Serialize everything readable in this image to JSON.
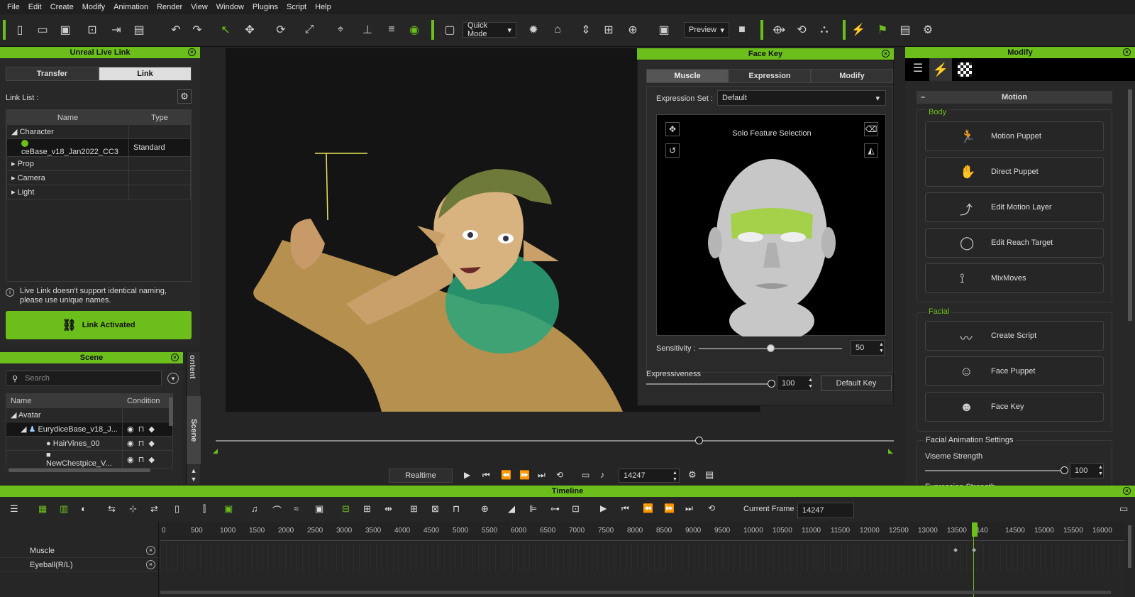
{
  "menubar": [
    "File",
    "Edit",
    "Create",
    "Modify",
    "Animation",
    "Render",
    "View",
    "Window",
    "Plugins",
    "Script",
    "Help"
  ],
  "toolbar": {
    "quick_mode": "Quick Mode",
    "preview": "Preview"
  },
  "live_link": {
    "title": "Unreal Live Link",
    "tab_transfer": "Transfer",
    "tab_link": "Link",
    "link_list_label": "Link List :",
    "col_name": "Name",
    "col_type": "Type",
    "rows": [
      {
        "name": "Character",
        "type": ""
      },
      {
        "name": "ceBase_v18_Jan2022_CC3",
        "type": "Standard"
      },
      {
        "name": "Prop",
        "type": ""
      },
      {
        "name": "Camera",
        "type": ""
      },
      {
        "name": "Light",
        "type": ""
      }
    ],
    "info": "Live Link doesn't support identical naming, please use unique names.",
    "link_button": "Link Activated"
  },
  "scene": {
    "title": "Scene",
    "search_placeholder": "Search",
    "col_name": "Name",
    "col_condition": "Condition",
    "rows": [
      "Avatar",
      "EurydiceBase_v18_J...",
      "HairVines_00",
      "NewChestpice_V..."
    ],
    "side_tab_content": "ontent",
    "side_tab_scene": "Scene"
  },
  "face_key": {
    "title": "Face Key",
    "tabs": [
      "Muscle",
      "Expression",
      "Modify"
    ],
    "expression_set_label": "Expression Set :",
    "expression_set_value": "Default",
    "solo_label": "Solo Feature Selection",
    "sensitivity_label": "Sensitivity :",
    "sensitivity_value": "50",
    "sensitivity_level": 0.5,
    "expressiveness_label": "Expressiveness",
    "expressiveness_value": "100",
    "expressiveness_level": 1.0,
    "default_key": "Default Key"
  },
  "modify": {
    "title": "Modify",
    "section": "Motion",
    "body_label": "Body",
    "body_buttons": [
      "Motion Puppet",
      "Direct Puppet",
      "Edit Motion Layer",
      "Edit Reach Target",
      "MixMoves"
    ],
    "facial_label": "Facial",
    "facial_buttons": [
      "Create Script",
      "Face Puppet",
      "Face Key"
    ],
    "settings_label": "Facial Animation Settings",
    "viseme_label": "Viseme Strength",
    "viseme_value": "100",
    "viseme_level": 1.0,
    "expression_strength_label": "Expression Strength"
  },
  "playback": {
    "realtime": "Realtime",
    "frame": "14247"
  },
  "timeline": {
    "title": "Timeline",
    "current_frame_label": "Current Frame :",
    "current_frame": "14247",
    "ruler": [
      "0",
      "500",
      "1000",
      "1500",
      "2000",
      "2500",
      "3000",
      "3500",
      "4000",
      "4500",
      "5000",
      "5500",
      "6000",
      "6500",
      "7000",
      "7500",
      "8000",
      "8500",
      "9000",
      "9500",
      "10000",
      "10500",
      "11000",
      "11500",
      "12000",
      "12500",
      "13000",
      "13500",
      "140",
      "14500",
      "15000",
      "15500",
      "16000"
    ],
    "tracks": [
      "Muscle",
      "Eyeball(R/L)"
    ]
  },
  "colors": {
    "accent": "#6cbf1b",
    "bg": "#252525"
  }
}
